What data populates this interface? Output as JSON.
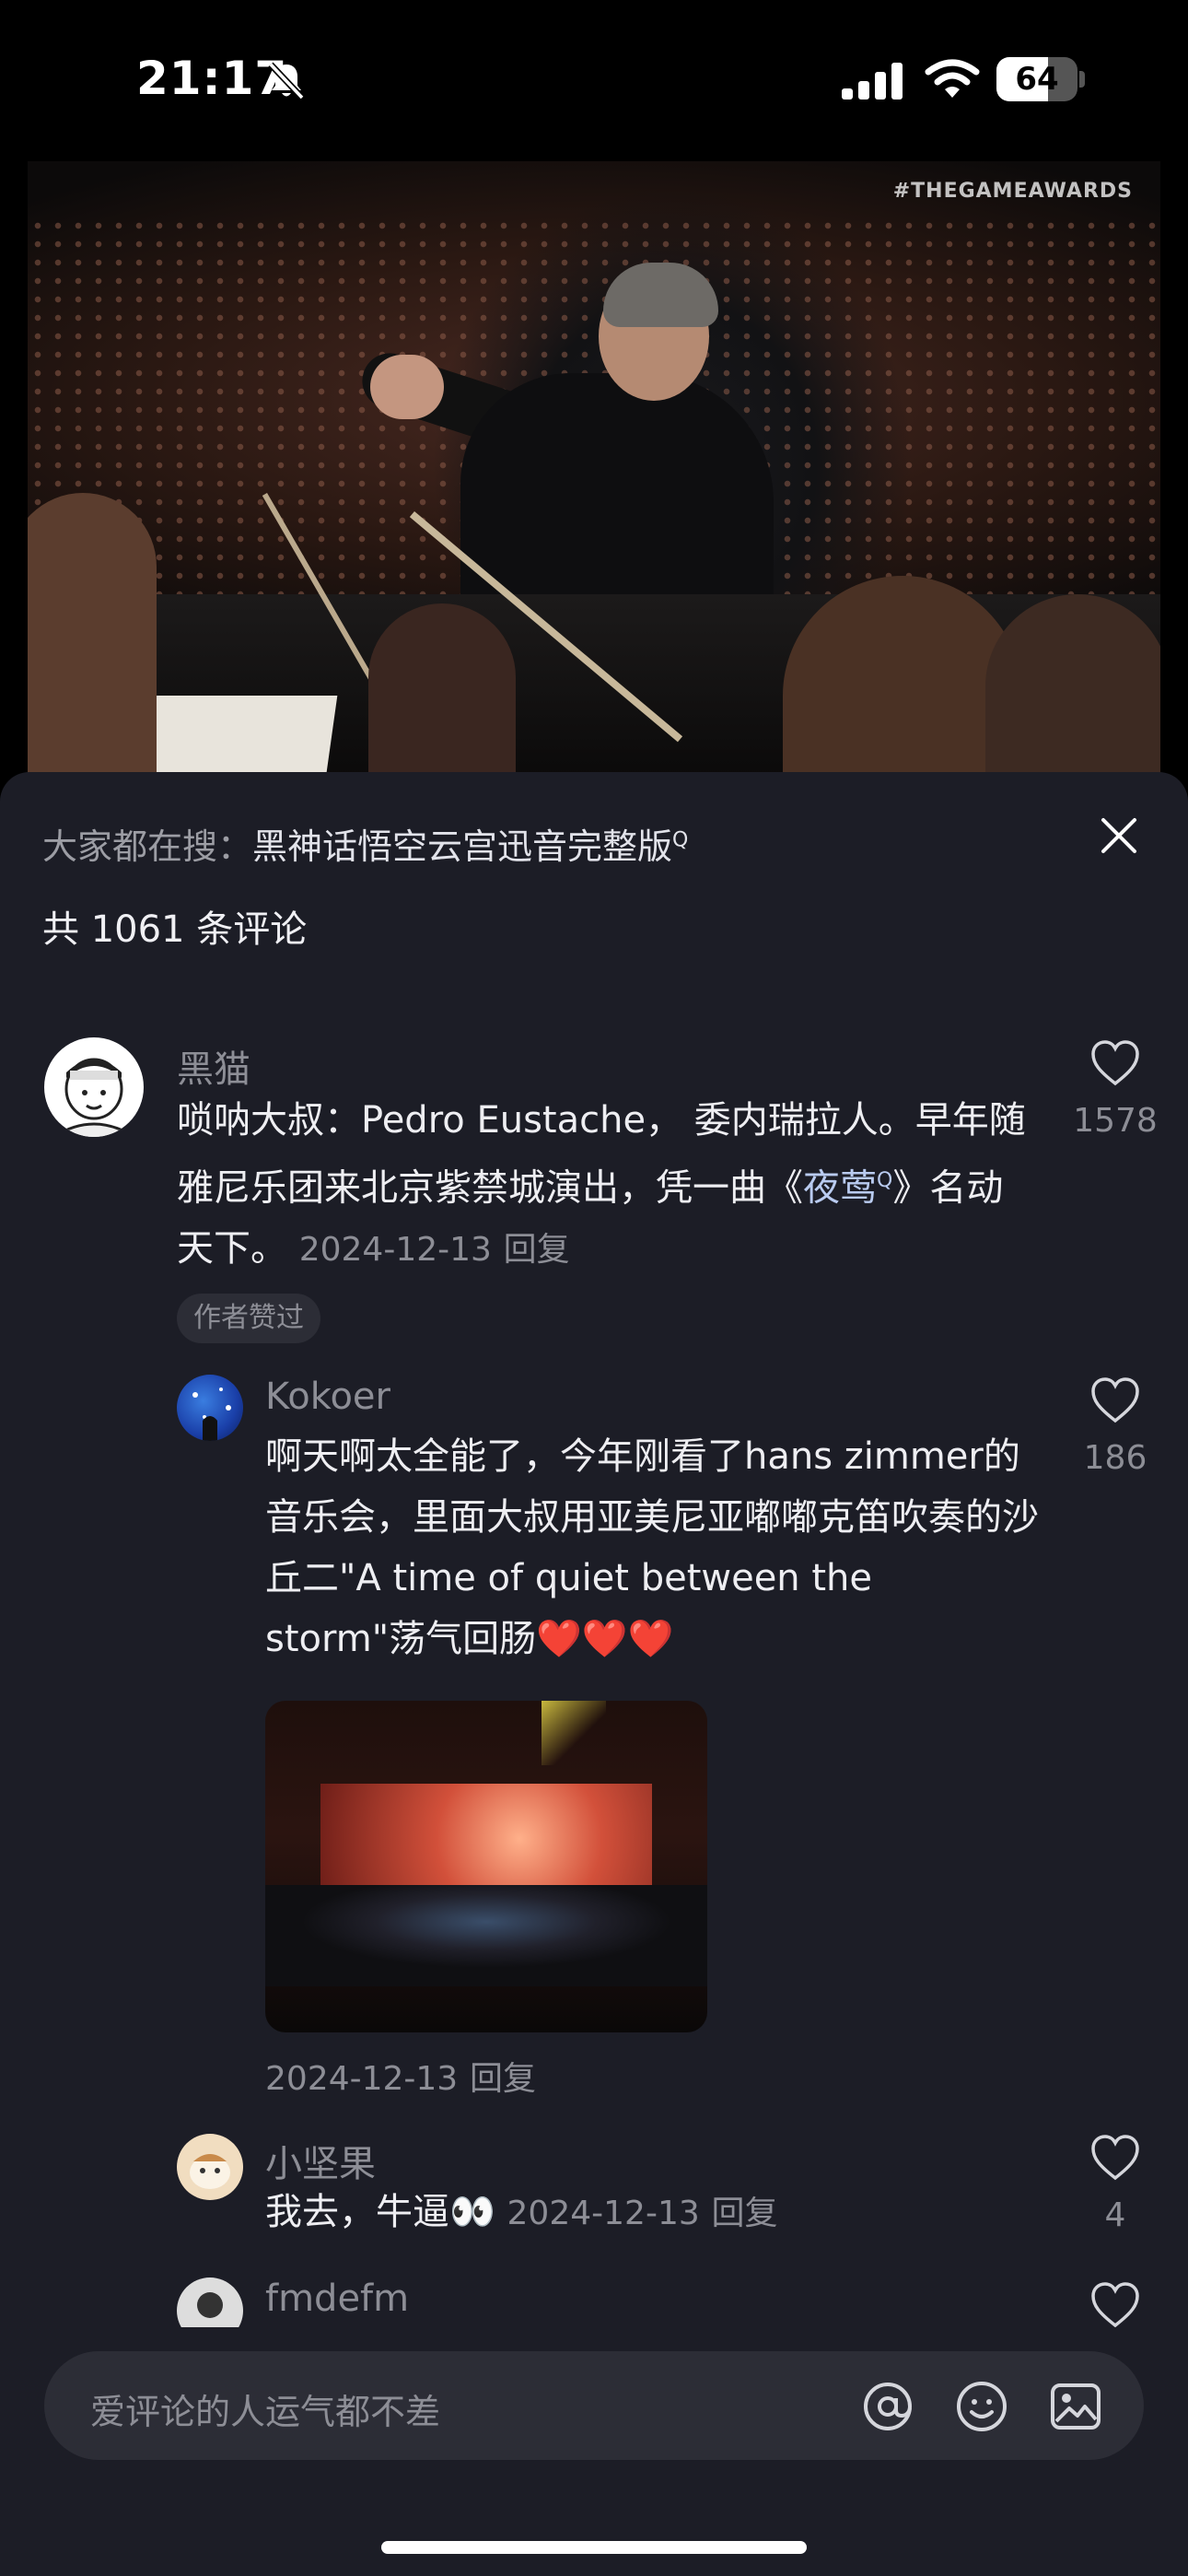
{
  "status_bar": {
    "time": "21:17",
    "battery": "64",
    "battery_level": 0.64
  },
  "video": {
    "watermark": "#THEGAMEAWARDS"
  },
  "comments_panel": {
    "search_prefix": "大家都在搜：",
    "search_keyword": "黑神话悟空云宫迅音完整版",
    "count_label": "共 1061 条评论",
    "comments": [
      {
        "username": "黑猫",
        "text_pre": "唢呐大叔：Pedro Eustache， 委内瑞拉人。早年随雅尼乐团来北京紫禁城演出，凭一曲《",
        "link": "夜莺",
        "text_post": "》名动天下。",
        "date": "2024-12-13",
        "reply": "回复",
        "likes": "1578",
        "badge": "作者赞过"
      },
      {
        "username": "Kokoer",
        "text": "啊天啊太全能了，今年刚看了hans zimmer的音乐会，里面大叔用亚美尼亚嘟嘟克笛吹奏的沙丘二\"A time of quiet between the storm\"荡气回肠❤️❤️❤️",
        "date": "2024-12-13",
        "reply": "回复",
        "likes": "186"
      },
      {
        "username": "小坚果",
        "text": "我去，牛逼👀",
        "date": "2024-12-13",
        "reply": "回复",
        "likes": "4"
      },
      {
        "username": "fmdefm"
      }
    ]
  },
  "input": {
    "placeholder": "爱评论的人运气都不差"
  },
  "icons": {
    "close": "close-icon",
    "like": "heart-icon",
    "mention": "at-icon",
    "emoji": "emoji-icon",
    "image": "image-icon"
  }
}
